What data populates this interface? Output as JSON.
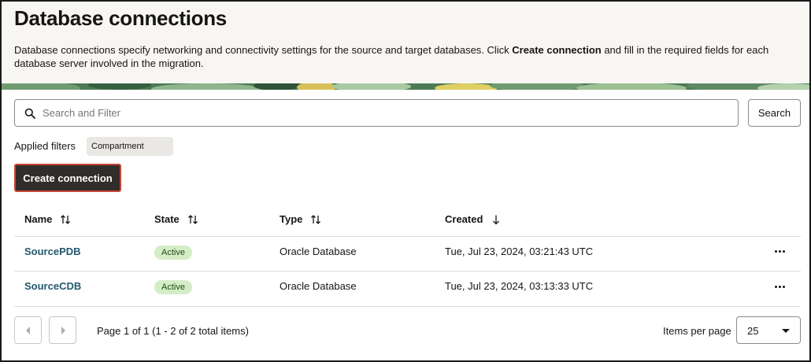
{
  "header": {
    "title": "Database connections",
    "description_before": "Database connections specify networking and connectivity settings for the source and target databases. Click ",
    "description_bold": "Create connection",
    "description_after": " and fill in the required fields for each database server involved in the migration."
  },
  "search": {
    "placeholder": "Search and Filter",
    "value": "",
    "button_label": "Search",
    "icon": "search-icon"
  },
  "filters": {
    "label": "Applied filters",
    "chips": [
      "Compartment"
    ]
  },
  "toolbar": {
    "create_label": "Create connection",
    "accent": "#c74634"
  },
  "table": {
    "columns": [
      {
        "label": "Name",
        "sort": "sortable"
      },
      {
        "label": "State",
        "sort": "sortable"
      },
      {
        "label": "Type",
        "sort": "sortable"
      },
      {
        "label": "Created",
        "sort": "descending"
      }
    ],
    "rows": [
      {
        "name": "SourcePDB",
        "state": "Active",
        "type": "Oracle Database",
        "created": "Tue, Jul 23, 2024, 03:21:43 UTC"
      },
      {
        "name": "SourceCDB",
        "state": "Active",
        "type": "Oracle Database",
        "created": "Tue, Jul 23, 2024, 03:13:33 UTC"
      }
    ],
    "link_color": "#22596f",
    "badge_color": "#d4edc6"
  },
  "pagination": {
    "info": "Page 1 of 1 (1 - 2 of 2 total items)",
    "items_per_page_label": "Items per page",
    "items_per_page_value": "25"
  }
}
